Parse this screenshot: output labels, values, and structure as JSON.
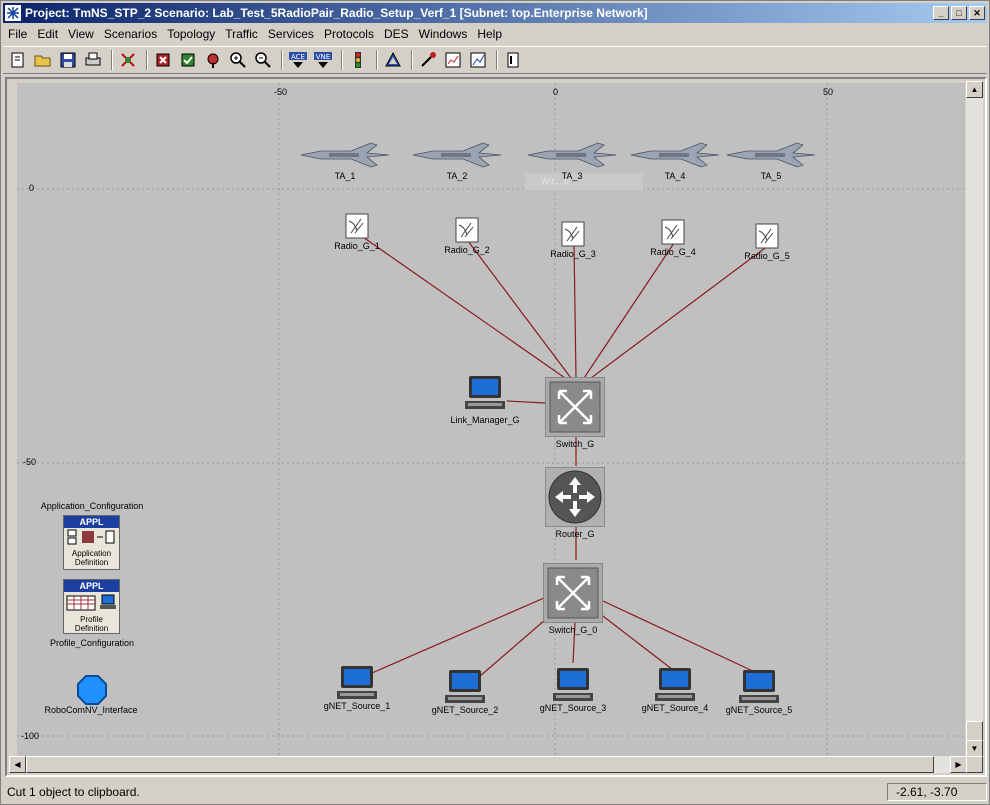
{
  "title": "Project: TmNS_STP_2 Scenario: Lab_Test_5RadioPair_Radio_Setup_Verf_1  [Subnet: top.Enterprise Network]",
  "menu": [
    "File",
    "Edit",
    "View",
    "Scenarios",
    "Topology",
    "Traffic",
    "Services",
    "Protocols",
    "DES",
    "Windows",
    "Help"
  ],
  "toolbar": {
    "icons": [
      "new-project-icon",
      "open-icon",
      "save-icon",
      "print-icon",
      "object-palette-icon",
      "fail-node-icon",
      "recover-node-icon",
      "return-parent-icon",
      "zoom-in-icon",
      "zoom-out-icon",
      "ace-icon",
      "vne-icon",
      "configure-sim-icon",
      "results-icon",
      "hide-graphs-icon",
      "view-results-icon",
      "web-report-icon",
      "notes-icon"
    ],
    "ace_label": "ACE",
    "vne_label": "VNE"
  },
  "axis": {
    "x_ticks": [
      "-50",
      "0",
      "50"
    ],
    "y_ticks": [
      "0",
      "-50",
      "-100"
    ]
  },
  "tooltip_ghost": "Wir... p",
  "nodes": {
    "aircraft": [
      "TA_1",
      "TA_2",
      "TA_3",
      "TA_4",
      "TA_5"
    ],
    "radios": [
      "Radio_G_1",
      "Radio_G_2",
      "Radio_G_3",
      "Radio_G_4",
      "Radio_G_5"
    ],
    "link_manager": "Link_Manager_G",
    "switch_g": "Switch_G",
    "router": "Router_G",
    "switch_g0": "Switch_G_0",
    "sources": [
      "gNET_Source_1",
      "gNET_Source_2",
      "gNET_Source_3",
      "gNET_Source_4",
      "gNET_Source_5"
    ],
    "app_config": {
      "label": "Application_Configuration",
      "badge": "APPL",
      "caption_line1": "Application",
      "caption_line2": "Definition"
    },
    "profile_config": {
      "label": "Profile_Configuration",
      "badge": "APPL",
      "caption_line1": "Profile",
      "caption_line2": "Definition"
    },
    "robocom": "RoboComNV_Interface"
  },
  "colors": {
    "link": "#8b1a1a",
    "canvas": "#c0c0c0",
    "grid": "#9a9a9a",
    "title_start": "#0a246a"
  },
  "status": {
    "message": "Cut 1 object to clipboard.",
    "coords": "-2.61, -3.70"
  }
}
